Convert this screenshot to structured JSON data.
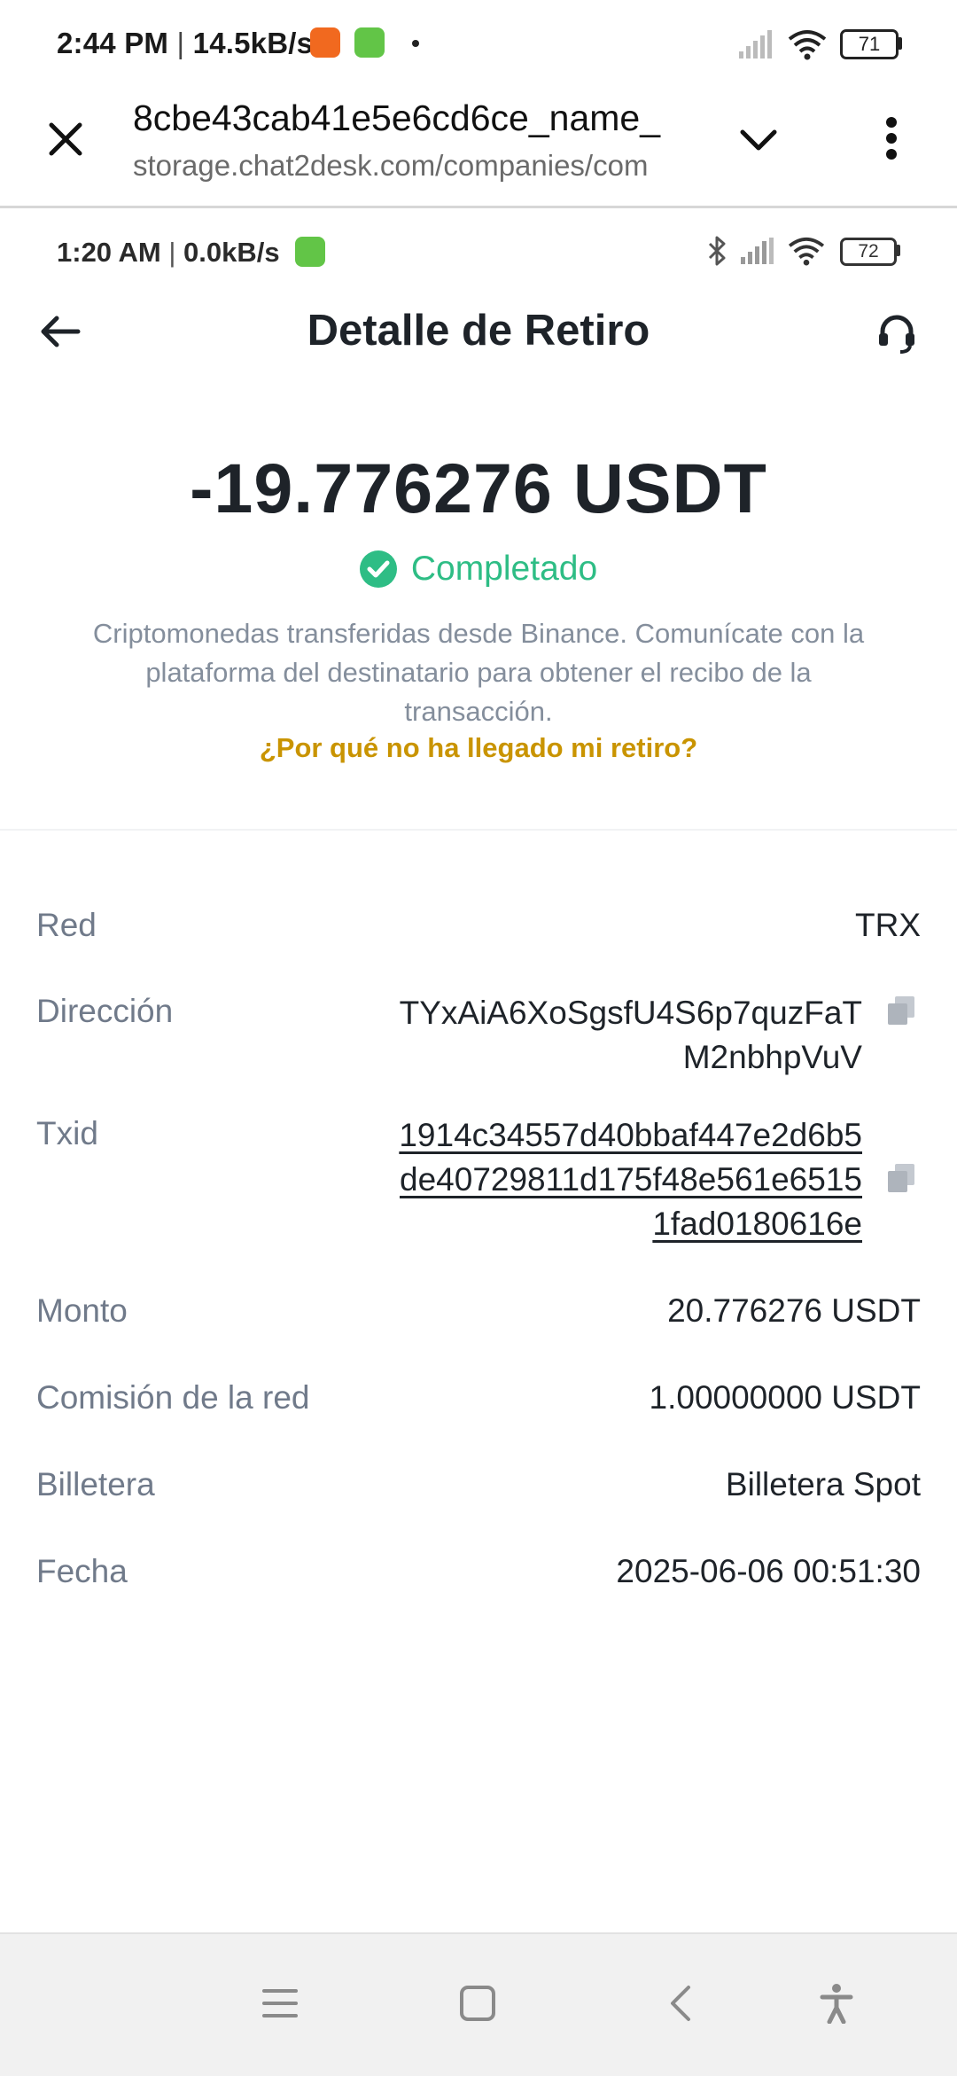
{
  "outer_status": {
    "time": "2:44 PM",
    "separator": "|",
    "speed": "14.5kB/s",
    "battery": "71"
  },
  "browser": {
    "title": "8cbe43cab41e5e6cd6ce_name_",
    "url": "storage.chat2desk.com/companies/com"
  },
  "inner_status": {
    "time": "1:20 AM",
    "separator": "|",
    "speed": "0.0kB/s",
    "battery": "72"
  },
  "header": {
    "title": "Detalle de Retiro"
  },
  "summary": {
    "amount": "-19.776276 USDT",
    "status": "Completado",
    "description": "Criptomonedas transferidas desde Binance. Comunícate con la plataforma del destinatario para obtener el recibo de la transacción.",
    "link": "¿Por qué no ha llegado mi retiro?"
  },
  "details": {
    "network_label": "Red",
    "network_value": "TRX",
    "address_label": "Dirección",
    "address_line1": "TYxAiA6XoSgsfU4S6p7quzFaT",
    "address_line2": "M2nbhpVuV",
    "txid_label": "Txid",
    "txid_line1": "1914c34557d40bbaf447e2d6b5",
    "txid_line2": "de40729811d175f48e561e6515",
    "txid_line3": "1fad0180616e",
    "amount_label": "Monto",
    "amount_value": "20.776276 USDT",
    "fee_label": "Comisión de la red",
    "fee_value": "1.00000000 USDT",
    "wallet_label": "Billetera",
    "wallet_value": "Billetera Spot",
    "date_label": "Fecha",
    "date_value": "2025-06-06 00:51:30"
  },
  "colors": {
    "success": "#2ebd85",
    "link": "#c99400",
    "text_primary": "#1e2329",
    "text_secondary": "#707a8a"
  },
  "icons": {
    "close": "close-icon",
    "dropdown": "chevron-down-icon",
    "menu": "more-vert-icon",
    "back": "arrow-left-icon",
    "support": "headset-icon",
    "status": "check-circle-icon",
    "copy": "copy-icon",
    "nav": [
      "menu-lines-icon",
      "square-home-icon",
      "chevron-back-icon",
      "accessibility-icon"
    ]
  }
}
